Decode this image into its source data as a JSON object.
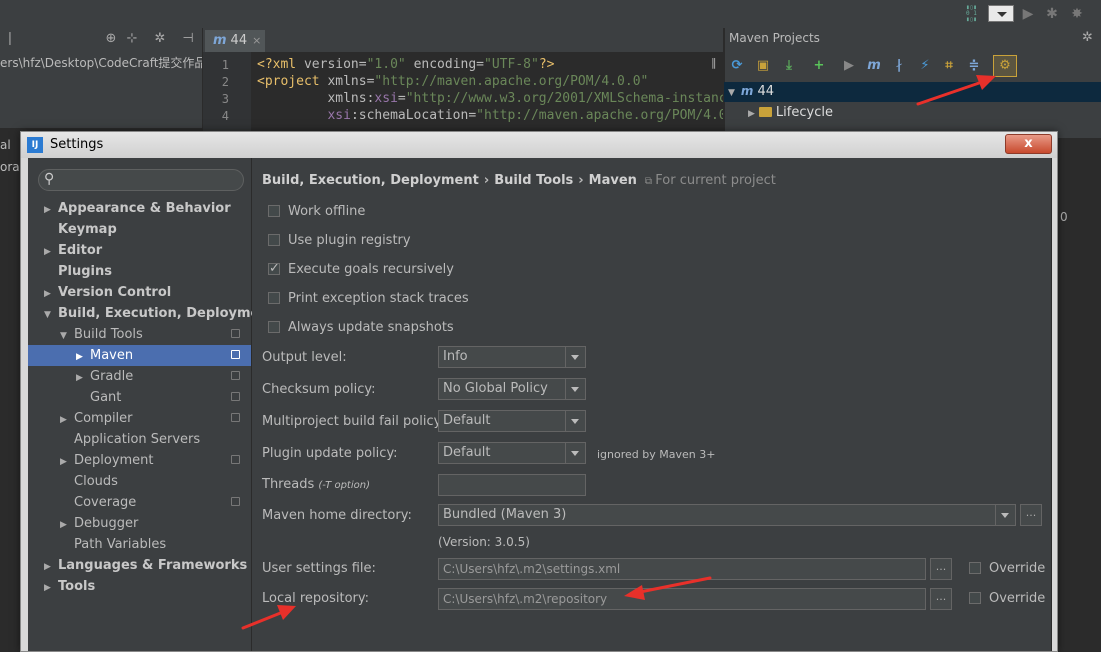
{
  "toolbar": {
    "run_config_value": "",
    "icons": [
      "vcs-icon",
      "run-icon",
      "debug-icon",
      "coverage-icon"
    ]
  },
  "project_panel": {
    "path_text": "ers\\hfz\\Desktop\\CodeCraft提交作品",
    "behind_left_1": "al",
    "behind_left_2": "orari"
  },
  "editor": {
    "tab_icon": "m",
    "tab_label": "44",
    "tab_close": "×",
    "line_numbers": [
      "1",
      "2",
      "3",
      "4"
    ]
  },
  "maven": {
    "title": "Maven Projects",
    "root_node": "44",
    "lifecycle_node": "Lifecycle",
    "behind_right_text": "0"
  },
  "dialog": {
    "title": "Settings",
    "icon_text": "IJ",
    "close_label": "x",
    "search_placeholder": "",
    "breadcrumb": [
      "Build, Execution, Deployment",
      "Build Tools",
      "Maven"
    ],
    "for_current_project": "For current project",
    "tree": [
      {
        "label": "Appearance & Behavior",
        "level": 0,
        "arrow": "right",
        "bold": true
      },
      {
        "label": "Keymap",
        "level": 0,
        "arrow": "",
        "bold": true
      },
      {
        "label": "Editor",
        "level": 0,
        "arrow": "right",
        "bold": true
      },
      {
        "label": "Plugins",
        "level": 0,
        "arrow": "",
        "bold": true
      },
      {
        "label": "Version Control",
        "level": 0,
        "arrow": "right",
        "bold": true
      },
      {
        "label": "Build, Execution, Deployment",
        "level": 0,
        "arrow": "down",
        "bold": true
      },
      {
        "label": "Build Tools",
        "level": 1,
        "arrow": "down",
        "bold": false,
        "proj": true
      },
      {
        "label": "Maven",
        "level": 2,
        "arrow": "right",
        "bold": false,
        "proj": true,
        "selected": true
      },
      {
        "label": "Gradle",
        "level": 2,
        "arrow": "right",
        "bold": false,
        "proj": true
      },
      {
        "label": "Gant",
        "level": 2,
        "arrow": "",
        "bold": false,
        "proj": true
      },
      {
        "label": "Compiler",
        "level": 1,
        "arrow": "right",
        "bold": false,
        "proj": true
      },
      {
        "label": "Application Servers",
        "level": 1,
        "arrow": "",
        "bold": false
      },
      {
        "label": "Deployment",
        "level": 1,
        "arrow": "right",
        "bold": false,
        "proj": true
      },
      {
        "label": "Clouds",
        "level": 1,
        "arrow": "",
        "bold": false
      },
      {
        "label": "Coverage",
        "level": 1,
        "arrow": "",
        "bold": false,
        "proj": true
      },
      {
        "label": "Debugger",
        "level": 1,
        "arrow": "right",
        "bold": false
      },
      {
        "label": "Path Variables",
        "level": 1,
        "arrow": "",
        "bold": false
      },
      {
        "label": "Languages & Frameworks",
        "level": 0,
        "arrow": "right",
        "bold": true
      },
      {
        "label": "Tools",
        "level": 0,
        "arrow": "right",
        "bold": true
      }
    ],
    "checkboxes": [
      {
        "label": "Work offline",
        "checked": false
      },
      {
        "label": "Use plugin registry",
        "checked": false
      },
      {
        "label": "Execute goals recursively",
        "checked": true
      },
      {
        "label": "Print exception stack traces",
        "checked": false
      },
      {
        "label": "Always update snapshots",
        "checked": false
      }
    ],
    "output_level_label": "Output level:",
    "output_level_value": "Info",
    "checksum_label": "Checksum policy:",
    "checksum_value": "No Global Policy",
    "multiproject_label": "Multiproject build fail policy:",
    "multiproject_value": "Default",
    "plugin_update_label": "Plugin update policy:",
    "plugin_update_value": "Default",
    "plugin_update_hint": "ignored by Maven 3+",
    "threads_label": "Threads",
    "threads_hint": "(-T option)",
    "threads_value": "",
    "maven_home_label": "Maven home directory:",
    "maven_home_value": "Bundled (Maven 3)",
    "version_text": "(Version: 3.0.5)",
    "user_settings_label": "User settings file:",
    "user_settings_value": "C:\\Users\\hfz\\.m2\\settings.xml",
    "local_repo_label": "Local repository:",
    "local_repo_value": "C:\\Users\\hfz\\.m2\\repository",
    "override_label": "Override",
    "browse_label": "..."
  },
  "colors": {
    "arrow_red": "#e8302a",
    "selection_blue": "#4b6eaf",
    "panel_bg": "#3c3f41"
  }
}
